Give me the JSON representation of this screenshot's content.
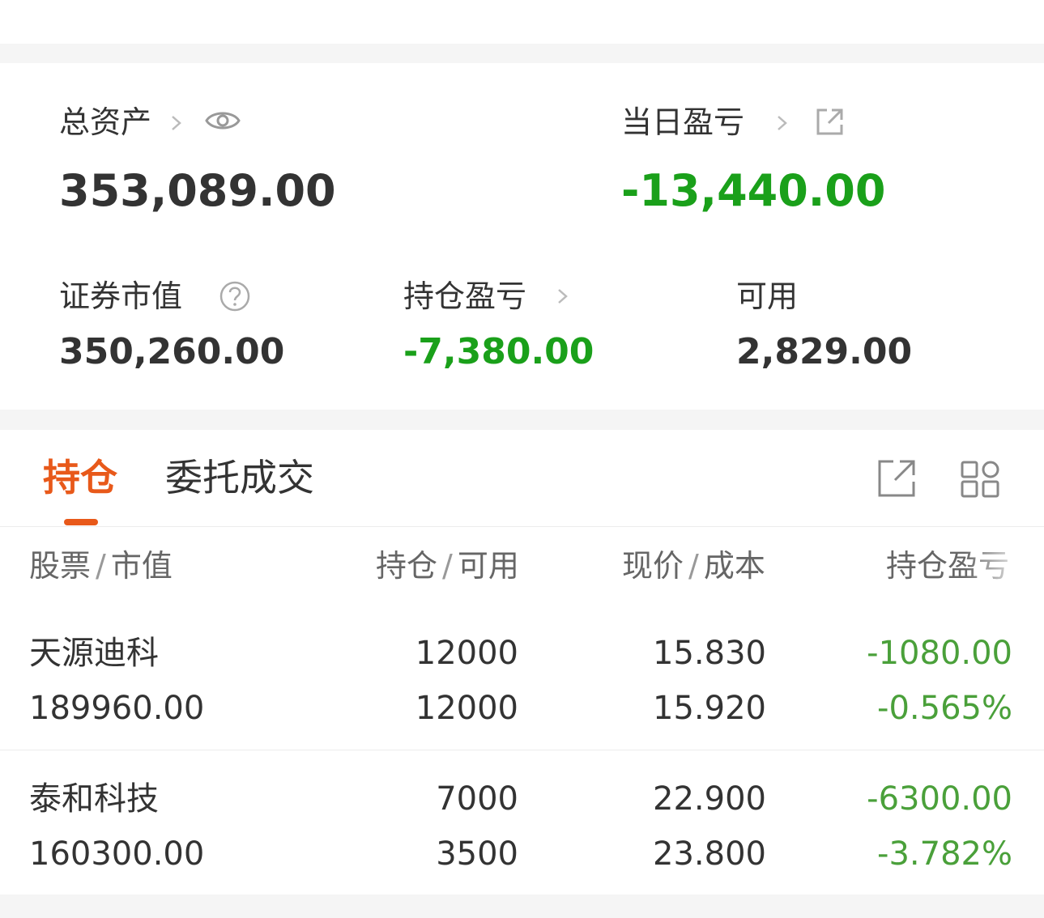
{
  "summary": {
    "total_assets_label": "总资产",
    "total_assets_value": "353,089.00",
    "daily_pnl_label": "当日盈亏",
    "daily_pnl_value": "-13,440.00",
    "market_value_label": "证券市值",
    "market_value_value": "350,260.00",
    "position_pnl_label": "持仓盈亏",
    "position_pnl_value": "-7,380.00",
    "available_label": "可用",
    "available_value": "2,829.00"
  },
  "tabs": {
    "positions": "持仓",
    "orders": "委托成交"
  },
  "table": {
    "headers": {
      "stock_a": "股票",
      "stock_b": "市值",
      "qty_a": "持仓",
      "qty_b": "可用",
      "price_a": "现价",
      "price_b": "成本",
      "pnl": "持仓盈亏"
    },
    "rows": [
      {
        "name": "天源迪科",
        "market_value": "189960.00",
        "holding": "12000",
        "available": "12000",
        "price": "15.830",
        "cost": "15.920",
        "pnl": "-1080.00",
        "pnl_pct": "-0.565%"
      },
      {
        "name": "泰和科技",
        "market_value": "160300.00",
        "holding": "7000",
        "available": "3500",
        "price": "22.900",
        "cost": "23.800",
        "pnl": "-6300.00",
        "pnl_pct": "-3.782%"
      }
    ]
  },
  "icons": {
    "eye": "eye-icon",
    "external": "external-link-icon",
    "help": "question-icon",
    "chevron": "chevron-right-icon",
    "share": "share-icon",
    "grid": "grid-icon"
  },
  "colors": {
    "accent": "#e8591a",
    "loss": "#1aa01a",
    "loss_table": "#4aa03a"
  }
}
